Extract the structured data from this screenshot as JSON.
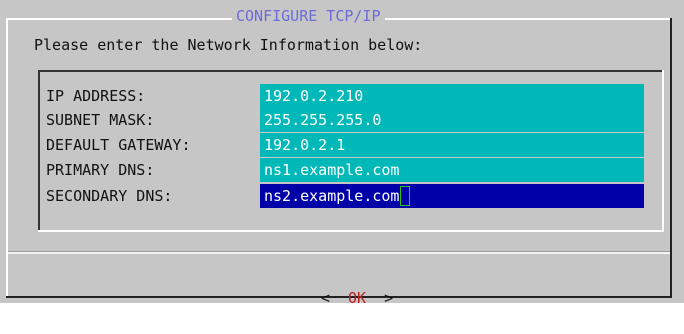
{
  "dialog": {
    "title": "CONFIGURE TCP/IP",
    "prompt": "Please enter the Network Information below:"
  },
  "form": {
    "fields": [
      {
        "label": "IP ADDRESS:",
        "value": "192.0.2.210"
      },
      {
        "label": "SUBNET MASK:",
        "value": "255.255.255.0"
      },
      {
        "label": "DEFAULT GATEWAY:",
        "value": "192.0.2.1"
      },
      {
        "label": "PRIMARY DNS:",
        "value": "ns1.example.com"
      },
      {
        "label": "SECONDARY DNS:",
        "value": "ns2.example.com",
        "focused": true
      }
    ]
  },
  "buttons": {
    "left_bracket": "<",
    "ok_label": "OK",
    "right_bracket": ">"
  },
  "colors": {
    "dialog_bg": "#c6c6c6",
    "title_text": "#6b6bd9",
    "field_bg": "#00b8b8",
    "field_focused_bg": "#0000a8",
    "field_text": "#ffffff",
    "cursor": "#22c522",
    "button_hotkey": "#b52020"
  }
}
